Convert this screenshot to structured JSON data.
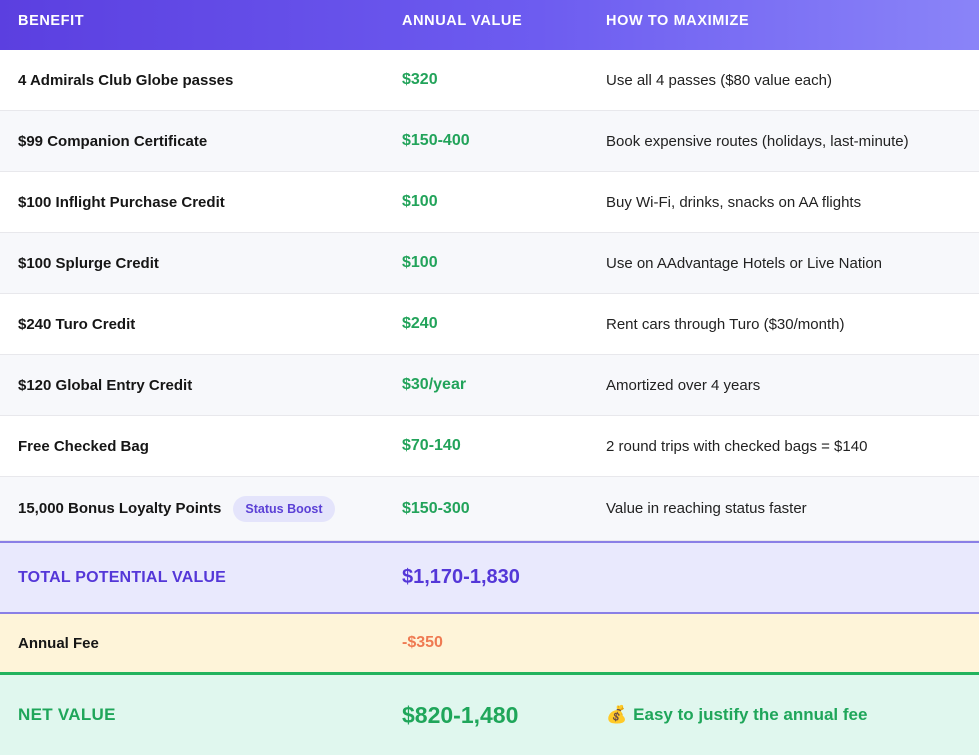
{
  "header": {
    "benefit": "BENEFIT",
    "annual_value": "ANNUAL VALUE",
    "how_to_maximize": "HOW TO MAXIMIZE"
  },
  "rows": [
    {
      "benefit": "4 Admirals Club Globe passes",
      "value": "$320",
      "how": "Use all 4 passes ($80 value each)"
    },
    {
      "benefit": "$99 Companion Certificate",
      "value": "$150-400",
      "how": "Book expensive routes (holidays, last-minute)"
    },
    {
      "benefit": "$100 Inflight Purchase Credit",
      "value": "$100",
      "how": "Buy Wi-Fi, drinks, snacks on AA flights"
    },
    {
      "benefit": "$100 Splurge Credit",
      "value": "$100",
      "how": "Use on AAdvantage Hotels or Live Nation"
    },
    {
      "benefit": "$240 Turo Credit",
      "value": "$240",
      "how": "Rent cars through Turo ($30/month)"
    },
    {
      "benefit": "$120 Global Entry Credit",
      "value": "$30/year",
      "how": "Amortized over 4 years"
    },
    {
      "benefit": "Free Checked Bag",
      "value": "$70-140",
      "how": "2 round trips with checked bags = $140"
    },
    {
      "benefit": "15,000 Bonus Loyalty Points",
      "badge": "Status Boost",
      "value": "$150-300",
      "how": "Value in reaching status faster"
    }
  ],
  "total": {
    "label": "TOTAL POTENTIAL VALUE",
    "value": "$1,170-1,830"
  },
  "fee": {
    "label": "Annual Fee",
    "value": "-$350"
  },
  "net": {
    "label": "NET VALUE",
    "value": "$820-1,480",
    "icon": "money-bag-icon",
    "note": "Easy to justify the annual fee"
  },
  "colors": {
    "header_start": "#5b3fe0",
    "header_end": "#8a84f8",
    "value_green": "#22a35a",
    "total_purple": "#5437d8",
    "fee_orange": "#ef7a52",
    "net_green": "#1fa65a"
  }
}
